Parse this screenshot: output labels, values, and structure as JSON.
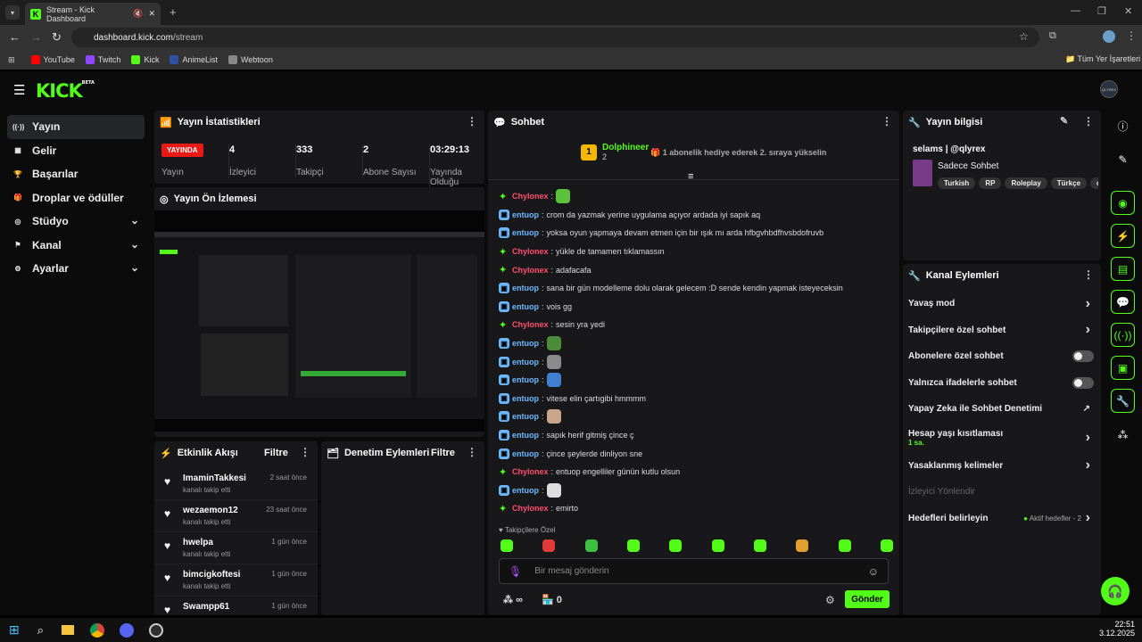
{
  "browser": {
    "tab_title": "Stream - Kick Dashboard",
    "url_host": "dashboard.kick.com",
    "url_path": "/stream",
    "bookmarks": [
      {
        "label": "YouTube",
        "color": "#ff0000"
      },
      {
        "label": "Twitch",
        "color": "#9146ff"
      },
      {
        "label": "Kick",
        "color": "#53fc18"
      },
      {
        "label": "AnimeList",
        "color": "#2e51a2"
      },
      {
        "label": "Webtoon",
        "color": "#888888"
      }
    ],
    "bookmarks_right": "Tüm Yer İşaretleri"
  },
  "app": {
    "logo": "KICK",
    "logo_sup": "BETA",
    "avatar_label": "QLYREX"
  },
  "sidebar": {
    "items": [
      {
        "label": "Yayın",
        "icon": "broadcast-icon",
        "glyph": "((·))"
      },
      {
        "label": "Gelir",
        "icon": "revenue-icon",
        "glyph": "▦"
      },
      {
        "label": "Başarılar",
        "icon": "trophy-icon",
        "glyph": "🏆"
      },
      {
        "label": "Droplar ve ödüller",
        "icon": "gift-icon",
        "glyph": "🎁"
      },
      {
        "label": "Stüdyo",
        "icon": "studio-icon",
        "glyph": "◎"
      },
      {
        "label": "Kanal",
        "icon": "channel-icon",
        "glyph": "⚑"
      },
      {
        "label": "Ayarlar",
        "icon": "settings-icon",
        "glyph": "⚙"
      }
    ]
  },
  "stats": {
    "title": "Yayın İstatistikleri",
    "live_badge": "YAYINDA",
    "live_label": "Yayın",
    "items": [
      {
        "value": "4",
        "label": "İzleyici"
      },
      {
        "value": "333",
        "label": "Takipçi"
      },
      {
        "value": "2",
        "label": "Abone Sayısı"
      },
      {
        "value": "03:29:13",
        "label": "Yayında Olduğu"
      }
    ]
  },
  "preview": {
    "title": "Yayın Ön İzlemesi"
  },
  "activity": {
    "title": "Etkinlik Akışı",
    "filter": "Filtre",
    "events": [
      {
        "name": "ImaminTakkesi",
        "sub": "kanalı takip etti",
        "time": "2 saat önce"
      },
      {
        "name": "wezaemon12",
        "sub": "kanalı takip etti",
        "time": "23 saat önce"
      },
      {
        "name": "hwelpa",
        "sub": "kanalı takip etti",
        "time": "1 gün önce"
      },
      {
        "name": "bimcigkoftesi",
        "sub": "kanalı takip etti",
        "time": "1 gün önce"
      },
      {
        "name": "Swampp61",
        "sub": "",
        "time": "1 gün önce"
      }
    ]
  },
  "moderation": {
    "title": "Denetim Eylemleri",
    "filter": "Filtre"
  },
  "chat": {
    "title": "Sohbet",
    "top_user": "Dolphineer",
    "top_rank": "1",
    "top_count": "2",
    "gift_msg": "1 abonelik hediye ederek 2. sıraya yükselin",
    "lines": [
      {
        "user": "Chylonex",
        "color": "#ff4d6d",
        "badge": "star",
        "msg": "",
        "emote": "#5cc23c"
      },
      {
        "user": "entuop",
        "color": "#6cb8ff",
        "badge": "box",
        "msg": "crom da yazmak yerine uygulama açıyor ardada iyi sapık aq",
        "emote": ""
      },
      {
        "user": "entuop",
        "color": "#6cb8ff",
        "badge": "box",
        "msg": "yoksa oyun yapmaya devam etmen için bir ışık mı arda hfbgvhbdfhvsbdofruvb",
        "emote": ""
      },
      {
        "user": "Chylonex",
        "color": "#ff4d6d",
        "badge": "star",
        "msg": "yükle de tamamen tıklamassın",
        "emote": ""
      },
      {
        "user": "Chylonex",
        "color": "#ff4d6d",
        "badge": "star",
        "msg": "adafacafa",
        "emote": ""
      },
      {
        "user": "entuop",
        "color": "#6cb8ff",
        "badge": "box",
        "msg": "sana bir gün modelleme dolu olarak gelecem :D sende kendin yapmak isteyeceksin",
        "emote": ""
      },
      {
        "user": "entuop",
        "color": "#6cb8ff",
        "badge": "box",
        "msg": "vois gg",
        "emote": ""
      },
      {
        "user": "Chylonex",
        "color": "#ff4d6d",
        "badge": "star",
        "msg": "sesin yra yedi",
        "emote": ""
      },
      {
        "user": "entuop",
        "color": "#6cb8ff",
        "badge": "box",
        "msg": "",
        "emote": "#4a8c3a"
      },
      {
        "user": "entuop",
        "color": "#6cb8ff",
        "badge": "box",
        "msg": "",
        "emote": "#8a8a8a"
      },
      {
        "user": "entuop",
        "color": "#6cb8ff",
        "badge": "box",
        "msg": "",
        "emote": "#3f7fd0"
      },
      {
        "user": "entuop",
        "color": "#6cb8ff",
        "badge": "box",
        "msg": "vitese elin çartıgibi hmmmm",
        "emote": ""
      },
      {
        "user": "entuop",
        "color": "#6cb8ff",
        "badge": "box",
        "msg": "",
        "emote": "#c9a58a"
      },
      {
        "user": "entuop",
        "color": "#6cb8ff",
        "badge": "box",
        "msg": "sapık herif gitmiş çince ç",
        "emote": ""
      },
      {
        "user": "entuop",
        "color": "#6cb8ff",
        "badge": "box",
        "msg": "çince şeylerde dinliyon sne",
        "emote": ""
      },
      {
        "user": "Chylonex",
        "color": "#ff4d6d",
        "badge": "star",
        "msg": "entuop engelliler günün kutlu olsun",
        "emote": ""
      },
      {
        "user": "entuop",
        "color": "#6cb8ff",
        "badge": "box",
        "msg": "",
        "emote": "#dddddd"
      },
      {
        "user": "Chylonex",
        "color": "#ff4d6d",
        "badge": "star",
        "msg": "emirto",
        "emote": ""
      }
    ],
    "followers_only": "Takipçilere Özel",
    "emote_colors": [
      "#53fc18",
      "#e03a3a",
      "#3fbf3f",
      "#53fc18",
      "#53fc18",
      "#53fc18",
      "#53fc18",
      "#e0a030",
      "#53fc18",
      "#53fc18"
    ],
    "input_placeholder": "Bir mesaj gönderin",
    "points": "∞",
    "store_count": "0",
    "send": "Gönder"
  },
  "stream_info": {
    "title": "Yayın bilgisi",
    "stream_title": "selams | @qlyrex",
    "category": "Sadece Sohbet",
    "tags": [
      "Turkish",
      "RP",
      "Roleplay",
      "Türkçe",
      "c"
    ]
  },
  "channel_actions": {
    "title": "Kanal Eylemleri",
    "items": [
      {
        "label": "Yavaş mod",
        "kind": "arrow"
      },
      {
        "label": "Takipçilere özel sohbet",
        "kind": "arrow"
      },
      {
        "label": "Abonelere özel sohbet",
        "kind": "toggle"
      },
      {
        "label": "Yalnızca ifadelerle sohbet",
        "kind": "toggle"
      },
      {
        "label": "Yapay Zeka ile Sohbet Denetimi",
        "kind": "external"
      },
      {
        "label": "Hesap yaşı kısıtlaması",
        "kind": "arrow",
        "sub": "1 sa."
      },
      {
        "label": "Yasaklanmış kelimeler",
        "kind": "arrow"
      },
      {
        "label": "İzleyici Yönlendir",
        "kind": "disabled"
      },
      {
        "label": "Hedefleri belirleyin",
        "kind": "goal",
        "extra": "Aktif hedefler - 2"
      }
    ]
  },
  "taskbar": {
    "time": "22:51",
    "date": "3.12.2025"
  }
}
